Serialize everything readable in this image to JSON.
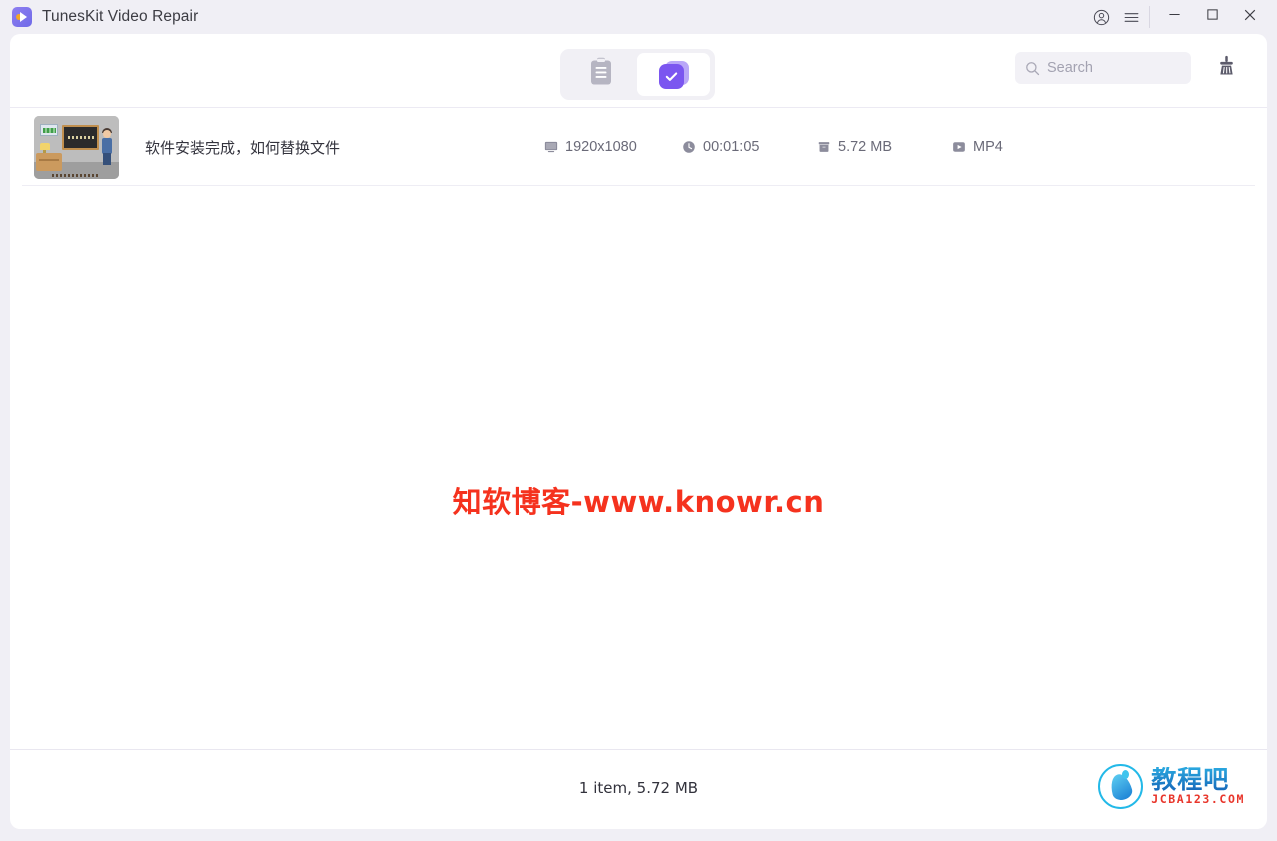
{
  "window": {
    "title": "TunesKit Video Repair",
    "app_icon": "tuneskit-play-wrench-icon",
    "accent_color": "#7b56f0",
    "background_color": "#f0eff5",
    "panel_color": "#ffffff",
    "titlebar_buttons": [
      {
        "name": "account",
        "icon": "user-circle-icon"
      },
      {
        "name": "menu",
        "icon": "hamburger-menu-icon"
      },
      {
        "name": "minimize",
        "icon": "minimize-icon"
      },
      {
        "name": "maximize",
        "icon": "maximize-icon"
      },
      {
        "name": "close",
        "icon": "close-icon"
      }
    ]
  },
  "toolbar": {
    "tabs": [
      {
        "name": "repair-list-tab",
        "icon": "clipboard-icon",
        "active": false
      },
      {
        "name": "repaired-tab",
        "icon": "check-square-icon",
        "active": true
      }
    ],
    "search": {
      "placeholder": "Search",
      "value": "",
      "icon": "search-icon"
    },
    "clean_button": {
      "icon": "broom-icon",
      "label": "Clean"
    }
  },
  "file_list": {
    "columns": [
      "thumbnail",
      "name",
      "resolution",
      "duration",
      "size",
      "format"
    ],
    "rows": [
      {
        "thumbnail": "classroom-blackboard-thumbnail",
        "name": "软件安装完成，如何替换文件",
        "resolution": "1920x1080",
        "resolution_icon": "monitor-icon",
        "duration": "00:01:05",
        "duration_icon": "clock-icon",
        "size": "5.72 MB",
        "size_icon": "file-box-icon",
        "format": "MP4",
        "format_icon": "video-play-icon"
      }
    ]
  },
  "watermark": {
    "text": "知软博客-www.knowr.cn",
    "color": "#f5321e"
  },
  "status_bar": {
    "summary": "1 item, 5.72 MB"
  },
  "brand": {
    "mark_icon": "water-drop-circle-icon",
    "name_cn": "教程吧",
    "url": "JCBA123.COM",
    "cn_color": "#1e8fd0",
    "url_color": "#e8352a"
  }
}
